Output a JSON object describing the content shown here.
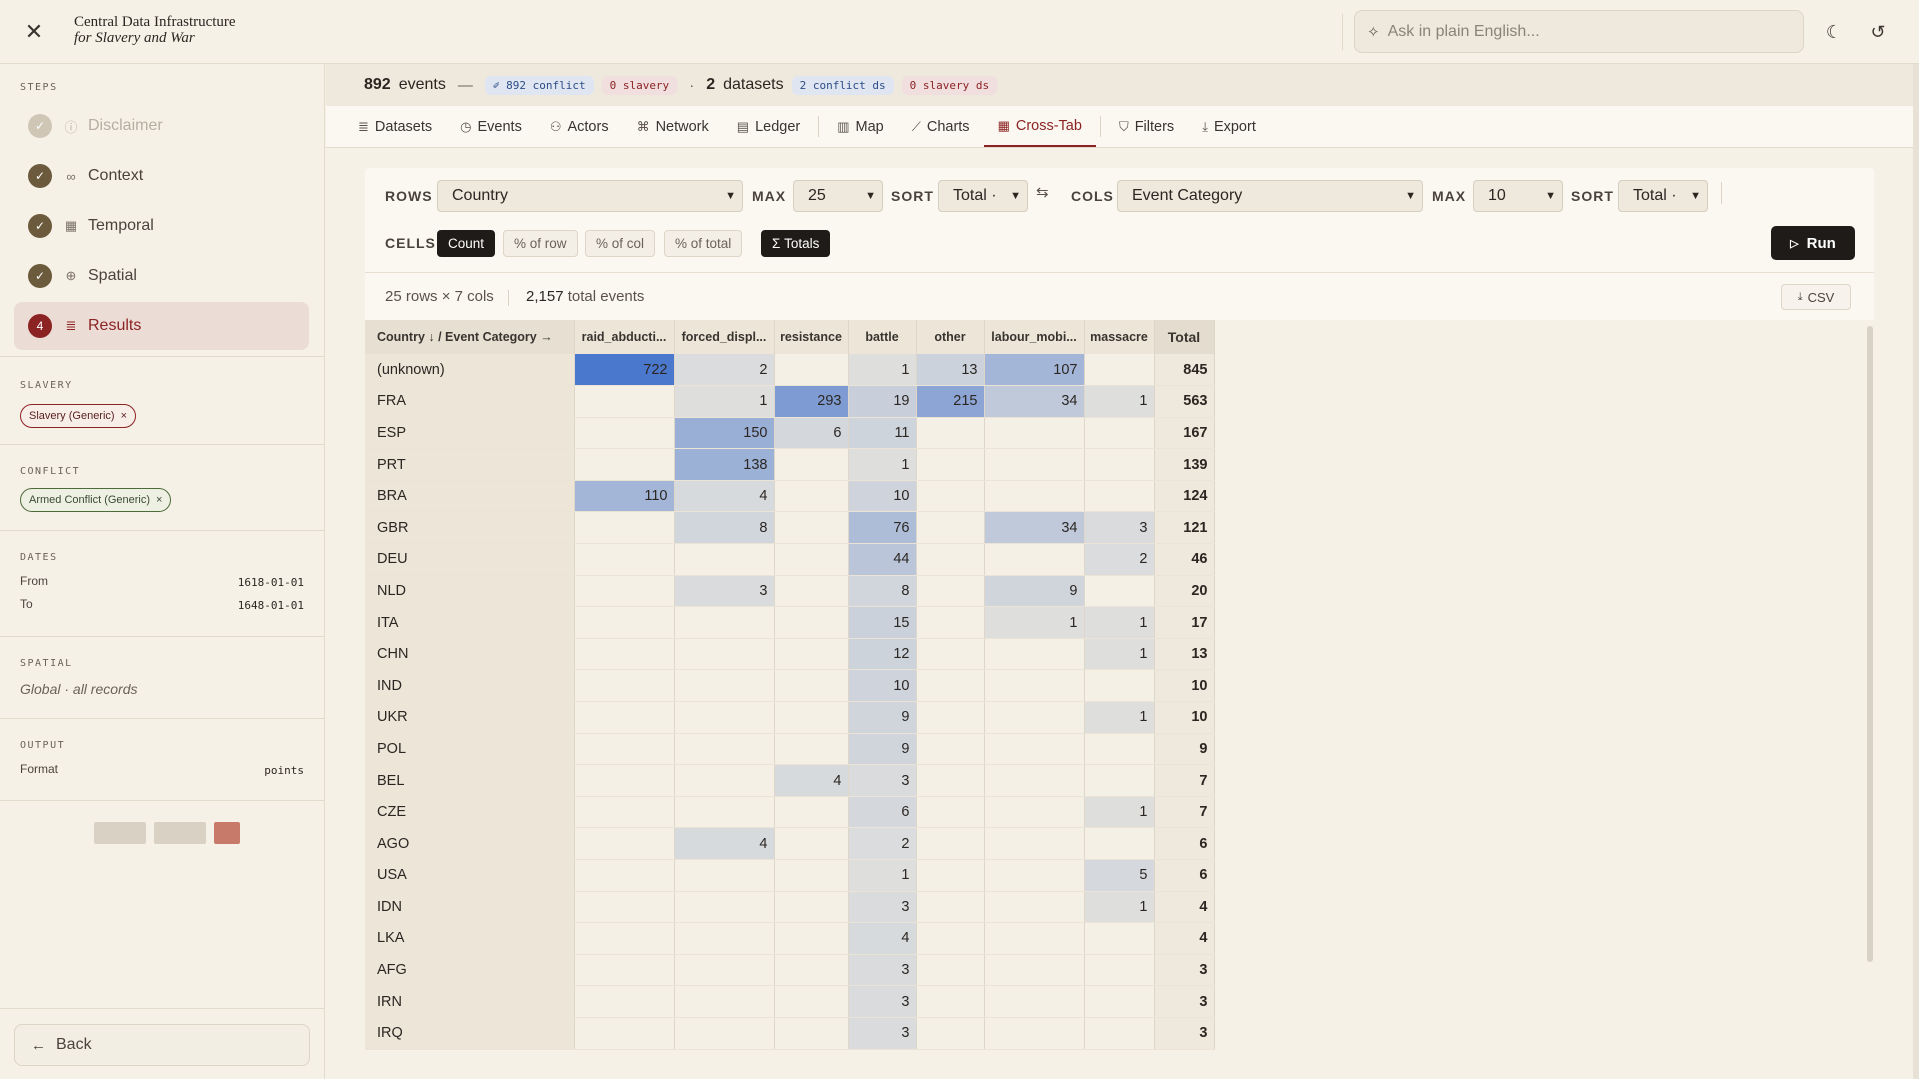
{
  "brand": {
    "line1": "Central Data Infrastructure",
    "line2": "for Slavery and War"
  },
  "ask": {
    "placeholder": "Ask in plain English..."
  },
  "sidebar": {
    "steps_label": "STEPS",
    "steps": [
      {
        "badge": "✓",
        "label": "Disclaimer",
        "icon": "info-icon",
        "state": "dim"
      },
      {
        "badge": "✓",
        "label": "Context",
        "icon": "link-icon",
        "state": "done"
      },
      {
        "badge": "✓",
        "label": "Temporal",
        "icon": "calendar-icon",
        "state": "done"
      },
      {
        "badge": "✓",
        "label": "Spatial",
        "icon": "globe-icon",
        "state": "done"
      },
      {
        "badge": "4",
        "label": "Results",
        "icon": "database-icon",
        "state": "active"
      }
    ],
    "slavery_label": "SLAVERY",
    "slavery_chip": "Slavery (Generic)",
    "conflict_label": "CONFLICT",
    "conflict_chip": "Armed Conflict (Generic)",
    "dates_label": "DATES",
    "from_label": "From",
    "from_value": "1618-01-01",
    "to_label": "To",
    "to_value": "1648-01-01",
    "spatial_label": "SPATIAL",
    "spatial_value": "Global · all records",
    "output_label": "OUTPUT",
    "format_label": "Format",
    "format_value": "points",
    "back_label": "Back"
  },
  "summary": {
    "events_count": "892",
    "events_label": "events",
    "dash": "—",
    "conflict_pill": "892 conflict",
    "slavery_pill": "0 slavery",
    "dot": "·",
    "datasets_count": "2",
    "datasets_label": "datasets",
    "conflict_ds_pill": "2 conflict ds",
    "slavery_ds_pill": "0 slavery ds"
  },
  "tabs": [
    {
      "label": "Datasets",
      "icon": "database-icon"
    },
    {
      "label": "Events",
      "icon": "clock-icon"
    },
    {
      "label": "Actors",
      "icon": "users-icon"
    },
    {
      "label": "Network",
      "icon": "network-icon"
    },
    {
      "label": "Ledger",
      "icon": "ledger-icon"
    },
    {
      "label": "Map",
      "icon": "map-icon"
    },
    {
      "label": "Charts",
      "icon": "chart-icon"
    },
    {
      "label": "Cross-Tab",
      "icon": "table-icon"
    },
    {
      "label": "Filters",
      "icon": "filter-icon"
    },
    {
      "label": "Export",
      "icon": "download-icon"
    }
  ],
  "controls": {
    "rows_label": "ROWS",
    "rows_value": "Country",
    "max_label": "MAX",
    "rows_max": "25",
    "sort_label": "SORT",
    "rows_sort": "Total ·",
    "cols_label": "COLS",
    "cols_value": "Event Category",
    "cols_max": "10",
    "cols_sort": "Total ·",
    "cells_label": "CELLS",
    "cell_modes": [
      "Count",
      "% of row",
      "% of col",
      "% of total"
    ],
    "totals_label": "Σ Totals",
    "run_label": "Run"
  },
  "meta": {
    "dims": "25 rows × 7 cols",
    "total_count": "2,157",
    "total_label": "total events",
    "csv_label": "CSV"
  },
  "table": {
    "corner": "Country ↓ / Event Category →",
    "columns": [
      "raid_abducti...",
      "forced_displ...",
      "resistance",
      "battle",
      "other",
      "labour_mobi...",
      "massacre"
    ],
    "total_header": "Total",
    "rows": [
      {
        "label": "(unknown)",
        "cells": [
          "722",
          "2",
          "",
          "1",
          "13",
          "107",
          ""
        ],
        "total": "845"
      },
      {
        "label": "FRA",
        "cells": [
          "",
          "1",
          "293",
          "19",
          "215",
          "34",
          "1"
        ],
        "total": "563"
      },
      {
        "label": "ESP",
        "cells": [
          "",
          "150",
          "6",
          "11",
          "",
          "",
          ""
        ],
        "total": "167"
      },
      {
        "label": "PRT",
        "cells": [
          "",
          "138",
          "",
          "1",
          "",
          "",
          ""
        ],
        "total": "139"
      },
      {
        "label": "BRA",
        "cells": [
          "110",
          "4",
          "",
          "10",
          "",
          "",
          ""
        ],
        "total": "124"
      },
      {
        "label": "GBR",
        "cells": [
          "",
          "8",
          "",
          "76",
          "",
          "34",
          "3"
        ],
        "total": "121"
      },
      {
        "label": "DEU",
        "cells": [
          "",
          "",
          "",
          "44",
          "",
          "",
          "2"
        ],
        "total": "46"
      },
      {
        "label": "NLD",
        "cells": [
          "",
          "3",
          "",
          "8",
          "",
          "9",
          ""
        ],
        "total": "20"
      },
      {
        "label": "ITA",
        "cells": [
          "",
          "",
          "",
          "15",
          "",
          "1",
          "1"
        ],
        "total": "17"
      },
      {
        "label": "CHN",
        "cells": [
          "",
          "",
          "",
          "12",
          "",
          "",
          "1"
        ],
        "total": "13"
      },
      {
        "label": "IND",
        "cells": [
          "",
          "",
          "",
          "10",
          "",
          "",
          ""
        ],
        "total": "10"
      },
      {
        "label": "UKR",
        "cells": [
          "",
          "",
          "",
          "9",
          "",
          "",
          "1"
        ],
        "total": "10"
      },
      {
        "label": "POL",
        "cells": [
          "",
          "",
          "",
          "9",
          "",
          "",
          ""
        ],
        "total": "9"
      },
      {
        "label": "BEL",
        "cells": [
          "",
          "",
          "4",
          "3",
          "",
          "",
          ""
        ],
        "total": "7"
      },
      {
        "label": "CZE",
        "cells": [
          "",
          "",
          "",
          "6",
          "",
          "",
          "1"
        ],
        "total": "7"
      },
      {
        "label": "AGO",
        "cells": [
          "",
          "4",
          "",
          "2",
          "",
          "",
          ""
        ],
        "total": "6"
      },
      {
        "label": "USA",
        "cells": [
          "",
          "",
          "",
          "1",
          "",
          "",
          "5"
        ],
        "total": "6"
      },
      {
        "label": "IDN",
        "cells": [
          "",
          "",
          "",
          "3",
          "",
          "",
          "1"
        ],
        "total": "4"
      },
      {
        "label": "LKA",
        "cells": [
          "",
          "",
          "",
          "4",
          "",
          "",
          ""
        ],
        "total": "4"
      },
      {
        "label": "AFG",
        "cells": [
          "",
          "",
          "",
          "3",
          "",
          "",
          ""
        ],
        "total": "3"
      },
      {
        "label": "IRN",
        "cells": [
          "",
          "",
          "",
          "3",
          "",
          "",
          ""
        ],
        "total": "3"
      },
      {
        "label": "IRQ",
        "cells": [
          "",
          "",
          "",
          "3",
          "",
          "",
          ""
        ],
        "total": "3"
      }
    ]
  }
}
